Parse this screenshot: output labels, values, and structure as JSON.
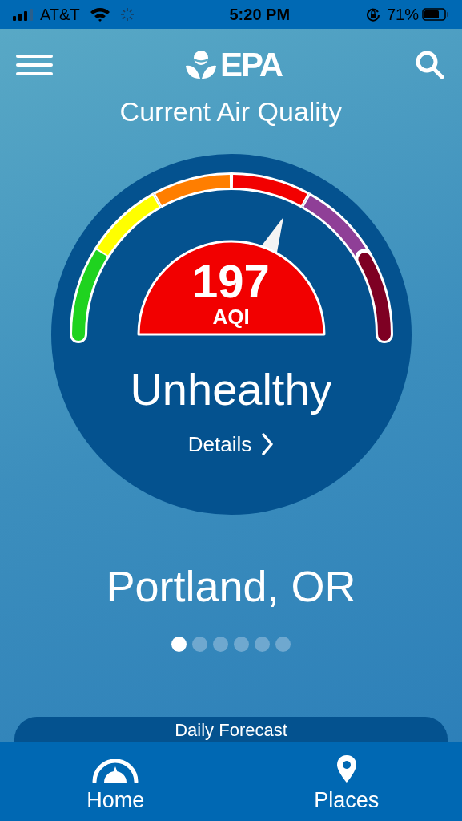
{
  "status_bar": {
    "carrier": "AT&T",
    "time": "5:20 PM",
    "battery": "71%"
  },
  "header": {
    "logo": "EPA"
  },
  "title": "Current Air Quality",
  "gauge": {
    "value": "197",
    "unit": "AQI",
    "segments": [
      {
        "color": "#1fd31f"
      },
      {
        "color": "#ffff00"
      },
      {
        "color": "#ff7e00"
      },
      {
        "color": "#f20000"
      },
      {
        "color": "#8f3f97"
      },
      {
        "color": "#7e0023"
      }
    ]
  },
  "category": "Unhealthy",
  "details_link": "Details",
  "location": "Portland, OR",
  "pages": [
    {
      "selected": true
    },
    {
      "selected": false
    },
    {
      "selected": false
    },
    {
      "selected": false
    },
    {
      "selected": false
    },
    {
      "selected": false
    }
  ],
  "forecast_card": {
    "title": "Daily Forecast"
  },
  "tab_bar": [
    {
      "label": "Home",
      "kind": "gauge"
    },
    {
      "label": "Places",
      "kind": "pin"
    }
  ]
}
